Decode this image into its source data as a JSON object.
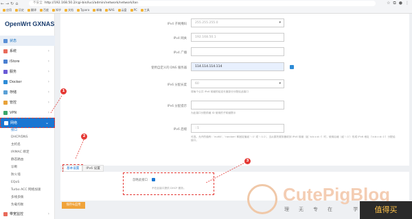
{
  "browser": {
    "url": "http://192.168.50.2/cgi-bin/luci/admin/network/network/lan",
    "security": "不安全",
    "bookmarks": [
      "应用",
      "历史",
      "翻译",
      "百度",
      "知乎",
      "文档",
      "Typora",
      "邮箱",
      "NAS",
      "云盘",
      "PC",
      "工具"
    ]
  },
  "sidebar": {
    "brand": "OpenWrt GXNAS",
    "items": [
      {
        "label": "状态",
        "color": "#5a8fd6"
      },
      {
        "label": "系统",
        "color": "#e86a5a"
      },
      {
        "label": "iStore",
        "color": "#4a7fd0"
      },
      {
        "label": "服务",
        "color": "#6a5ad6"
      },
      {
        "label": "Docker",
        "color": "#2d8bd6"
      },
      {
        "label": "存储",
        "color": "#5aa0d6"
      },
      {
        "label": "管控",
        "color": "#e8a23a"
      },
      {
        "label": "VPN",
        "color": "#3aa66a"
      },
      {
        "label": "网络",
        "color": "#ffffff"
      }
    ],
    "subitems": [
      "接口",
      "DHCP/DNS",
      "主机名",
      "IP/MAC 绑定",
      "静态路由",
      "诊断",
      "防火墙",
      "EQoS",
      "Turbo ACC 网络加速",
      "多线多拨",
      "负载均衡"
    ],
    "bottom_item": "带宽监控"
  },
  "form": {
    "rows": [
      {
        "label": "IPv4 子网掩码",
        "value": "255.255.255.0"
      },
      {
        "label": "IPv4 网关",
        "value": "192.168.50.1"
      },
      {
        "label": "IPv4 广播",
        "value": ""
      },
      {
        "label": "使用自定义的 DNS 服务器",
        "value": "114.114.114.114"
      },
      {
        "label": "IPv6 分配长度",
        "value": "60",
        "help": "将每个公共 IPv6 前缀的给定长度部分分配给此接口"
      },
      {
        "label": "IPv6 分配提示",
        "value": "",
        "help": "为此接口分配前缀 ID 使用的子前缀提示"
      },
      {
        "label": "IPv6 后缀",
        "value": "::1",
        "help": "可选。允许的值有：'eui64'、'random' 和固定值如 '::1' 或 '::1:2'。当从委托服务器收到 IPv6 前缀（如 'a:b:c:d::'）时，使用后缀（如 '::1'）形成 IPv6 地址（'a:b:c:d::1'）分配给接口。"
      }
    ]
  },
  "tabs": [
    "基本设置",
    "IPv6 设置"
  ],
  "panel": {
    "label": "忽略此接口",
    "help": "不在此接口提供 DHCP 服务。"
  },
  "save_button": "保存&应用",
  "badges": [
    "1",
    "2",
    "3"
  ],
  "watermark": {
    "brand": "CutePigBlog",
    "slogan": "理无专在 学无止境",
    "zdm": "值得买"
  }
}
